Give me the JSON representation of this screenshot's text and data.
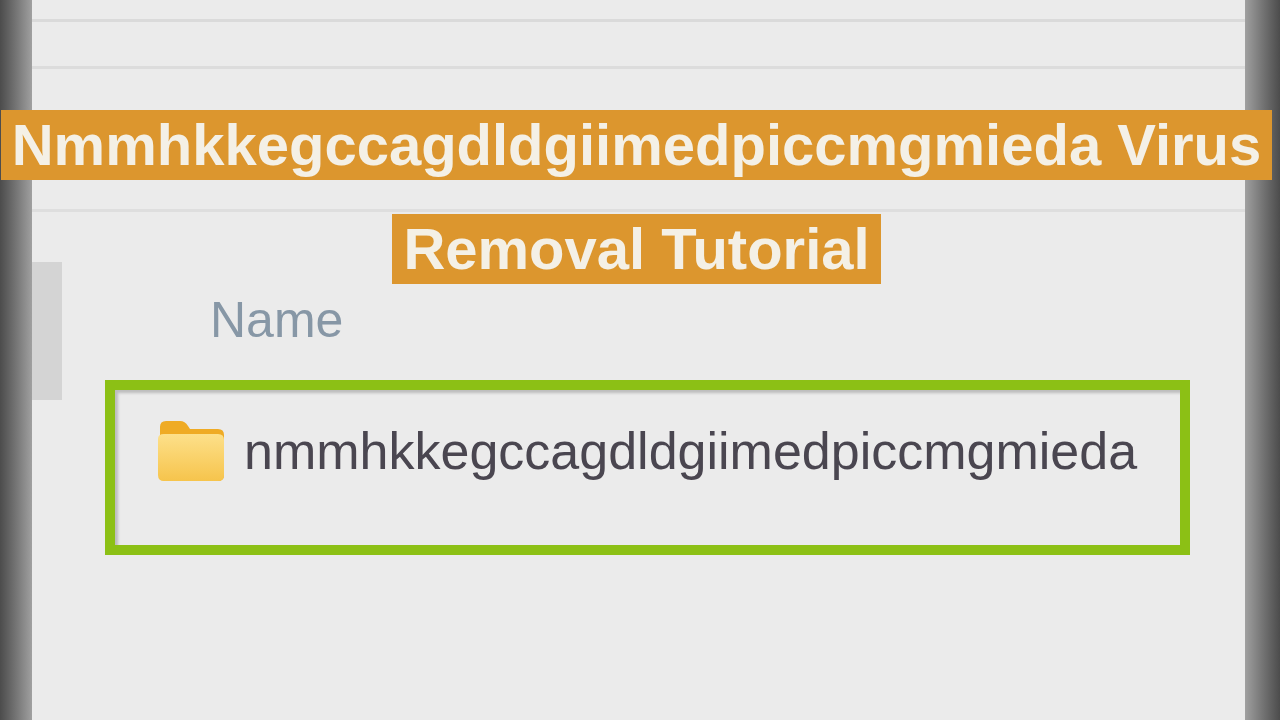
{
  "caption": {
    "lines": [
      "Nmmhkkegccagdldgiimedpiccmgmieda Virus",
      "Removal Tutorial"
    ]
  },
  "file_list": {
    "columns": [
      {
        "label": "Name"
      }
    ],
    "rows": [
      {
        "name": "nmmhkkegccagdldgiimedpiccmgmieda",
        "highlighted": true
      }
    ]
  }
}
